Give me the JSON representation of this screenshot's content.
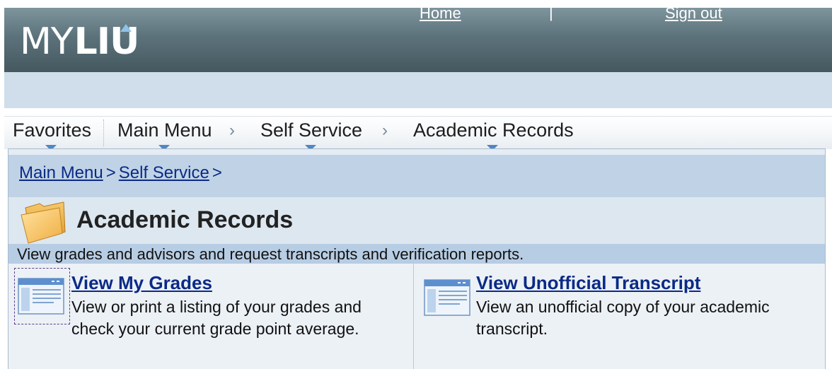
{
  "header": {
    "logo_text_thin": "MY",
    "logo_text_bold": "LIU",
    "home_link": "Home",
    "separator": "|",
    "signout_link": "Sign out"
  },
  "menubar": {
    "items": [
      {
        "label": "Favorites"
      },
      {
        "label": "Main Menu"
      },
      {
        "label": "Self Service"
      },
      {
        "label": "Academic Records"
      }
    ],
    "chevron": "›"
  },
  "breadcrumb": {
    "items": [
      "Main Menu",
      "Self Service"
    ],
    "separator": ">"
  },
  "page": {
    "title": "Academic Records",
    "description": "View grades and advisors and request transcripts and verification reports."
  },
  "cards": [
    {
      "title": "View My Grades",
      "description": "View or print a listing of your grades and check your current grade point average."
    },
    {
      "title": "View Unofficial Transcript",
      "description": "View an unofficial copy of your academic transcript."
    }
  ],
  "icons": {
    "folder": "folder-icon",
    "page": "page-window-icon",
    "dropdown": "dropdown-triangle-icon"
  },
  "colors": {
    "link": "#0b2a86",
    "header": "#5c727b",
    "menu_triangle": "#4f86c4"
  }
}
